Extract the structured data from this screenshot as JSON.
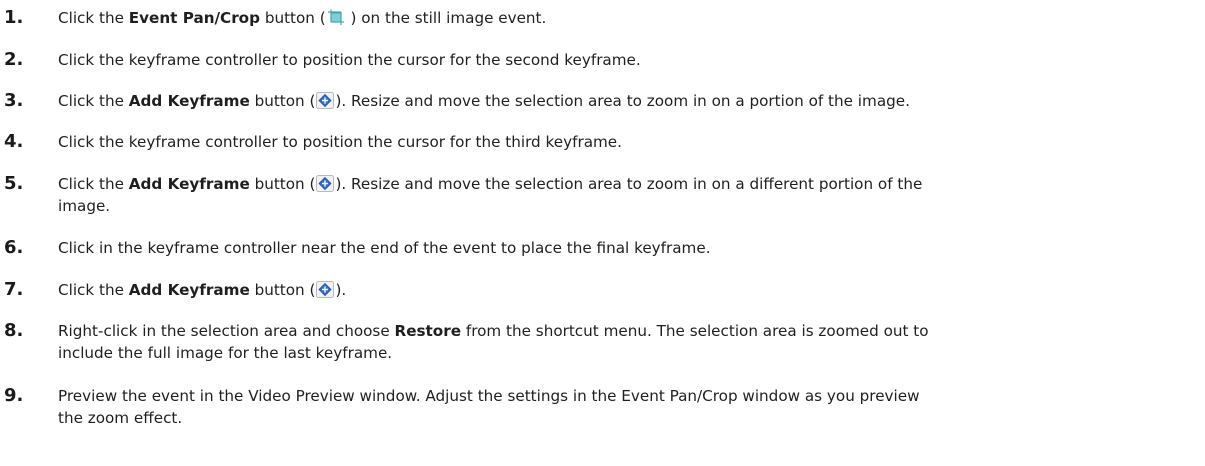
{
  "steps": [
    {
      "num": "1.",
      "pre": "Click the ",
      "bold": "Event Pan/Crop",
      "mid": " button (",
      "icon": "pan-crop-icon",
      "post": " ) on the still image event.",
      "rest": ""
    },
    {
      "num": "2.",
      "text": "Click the keyframe controller to position the cursor for the second keyframe."
    },
    {
      "num": "3.",
      "pre": "Click the ",
      "bold": "Add Keyframe",
      "mid": " button (",
      "icon": "add-keyframe-icon",
      "post": "). Resize and move the selection area to zoom in on a portion of the image."
    },
    {
      "num": "4.",
      "text": "Click the keyframe controller to position the cursor for the third keyframe."
    },
    {
      "num": "5.",
      "pre": "Click the ",
      "bold": "Add Keyframe",
      "mid": " button (",
      "icon": "add-keyframe-icon",
      "post": "). Resize and move the selection area to zoom in on a different portion of the",
      "line2": "image."
    },
    {
      "num": "6.",
      "text": "Click in the keyframe controller near the end of the event to place the final keyframe."
    },
    {
      "num": "7.",
      "pre": "Click the ",
      "bold": "Add Keyframe",
      "mid": " button (",
      "icon": "add-keyframe-icon",
      "post": ")."
    },
    {
      "num": "8.",
      "pre": "Right-click in the selection area and choose ",
      "bold": "Restore",
      "post": " from the shortcut menu. The selection area is zoomed out to",
      "line2": "include the full image for the last keyframe."
    },
    {
      "num": "9.",
      "text": "Preview the event in the Video Preview window. Adjust the settings in the Event Pan/Crop window as you preview",
      "line2": "the zoom effect."
    }
  ],
  "colors": {
    "pan_crop_icon": "#3fa7b0",
    "add_keyframe_icon": "#2f6fd1"
  }
}
